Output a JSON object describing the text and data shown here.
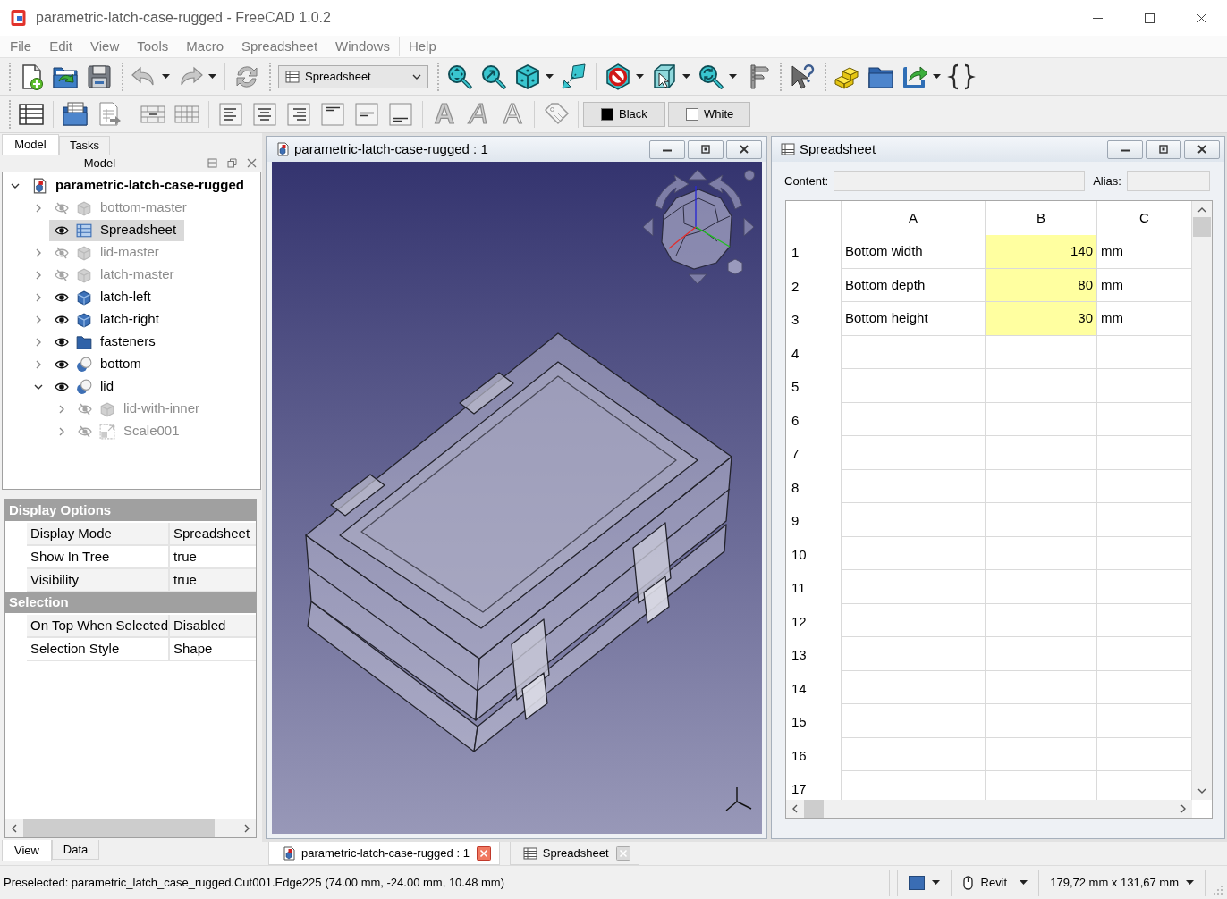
{
  "window": {
    "title": "parametric-latch-case-rugged - FreeCAD 1.0.2"
  },
  "menu_bar": [
    "File",
    "Edit",
    "View",
    "Tools",
    "Macro",
    "Spreadsheet",
    "Windows",
    "Help"
  ],
  "toolbar": {
    "workbench": "Spreadsheet",
    "style_buttons": [
      {
        "glyph": "A",
        "kind": "bold"
      },
      {
        "glyph": "A",
        "kind": "italic"
      },
      {
        "glyph": "A",
        "kind": "outline"
      }
    ],
    "color_buttons": [
      {
        "label": "Black",
        "color": "#000000"
      },
      {
        "label": "White",
        "color": "#ffffff"
      }
    ]
  },
  "combo_view": {
    "tabs": [
      {
        "label": "Model",
        "selected": true
      },
      {
        "label": "Tasks",
        "selected": false
      }
    ],
    "panel_title": "Model",
    "tree": {
      "label": "parametric-latch-case-rugged",
      "selected": false,
      "expanded": true,
      "children": [
        {
          "label": "bottom-master",
          "kind": "part",
          "visible": false,
          "selected": false,
          "expanded": false
        },
        {
          "label": "Spreadsheet",
          "kind": "spreadsheet",
          "visible": true,
          "selected": true
        },
        {
          "label": "lid-master",
          "kind": "part",
          "visible": false,
          "selected": false,
          "expanded": false
        },
        {
          "label": "latch-master",
          "kind": "part",
          "visible": false,
          "selected": false,
          "expanded": false
        },
        {
          "label": "latch-left",
          "kind": "body",
          "visible": true,
          "selected": false,
          "expanded": false
        },
        {
          "label": "latch-right",
          "kind": "body",
          "visible": true,
          "selected": false,
          "expanded": false
        },
        {
          "label": "fasteners",
          "kind": "folder",
          "visible": true,
          "selected": false,
          "expanded": false
        },
        {
          "label": "bottom",
          "kind": "boolean",
          "visible": true,
          "selected": false,
          "expanded": false
        },
        {
          "label": "lid",
          "kind": "boolean",
          "visible": true,
          "selected": false,
          "expanded": true,
          "children": [
            {
              "label": "lid-with-inner",
              "kind": "part",
              "visible": false,
              "selected": false,
              "expanded": false
            },
            {
              "label": "Scale001",
              "kind": "scale",
              "visible": false,
              "selected": false,
              "expanded": false
            }
          ]
        }
      ]
    },
    "property_groups": [
      {
        "name": "Display Options",
        "rows": [
          {
            "name": "Display Mode",
            "value": "Spreadsheet"
          },
          {
            "name": "Show In Tree",
            "value": "true"
          },
          {
            "name": "Visibility",
            "value": "true"
          }
        ]
      },
      {
        "name": "Selection",
        "rows": [
          {
            "name": "On Top When Selected",
            "value": "Disabled"
          },
          {
            "name": "Selection Style",
            "value": "Shape"
          }
        ]
      }
    ],
    "property_tabs": [
      {
        "label": "View",
        "selected": true
      },
      {
        "label": "Data",
        "selected": false
      }
    ]
  },
  "viewer_window": {
    "title": "parametric-latch-case-rugged : 1"
  },
  "spreadsheet_window": {
    "title": "Spreadsheet",
    "content_label": "Content:",
    "alias_label": "Alias:",
    "columns": [
      "A",
      "B",
      "C"
    ],
    "rows": [
      {
        "number": "1",
        "cells": [
          {
            "text": "Bottom width",
            "highlighted": false
          },
          {
            "text": "140",
            "highlighted": true
          },
          {
            "text": "mm",
            "highlighted": false
          }
        ]
      },
      {
        "number": "2",
        "cells": [
          {
            "text": "Bottom depth",
            "highlighted": false
          },
          {
            "text": "80",
            "highlighted": true
          },
          {
            "text": "mm",
            "highlighted": false
          }
        ]
      },
      {
        "number": "3",
        "cells": [
          {
            "text": "Bottom height",
            "highlighted": false
          },
          {
            "text": "30",
            "highlighted": true
          },
          {
            "text": "mm",
            "highlighted": false
          }
        ]
      },
      {
        "number": "4"
      },
      {
        "number": "5"
      },
      {
        "number": "6"
      },
      {
        "number": "7"
      },
      {
        "number": "8"
      },
      {
        "number": "9"
      },
      {
        "number": "10"
      },
      {
        "number": "11"
      },
      {
        "number": "12"
      },
      {
        "number": "13"
      },
      {
        "number": "14"
      },
      {
        "number": "15"
      },
      {
        "number": "16"
      },
      {
        "number": "17"
      }
    ]
  },
  "document_tabs": [
    {
      "label": "parametric-latch-case-rugged : 1",
      "kind": "viewer",
      "selected": true
    },
    {
      "label": "Spreadsheet",
      "kind": "spreadsheet",
      "selected": false
    }
  ],
  "status_bar": {
    "message": "Preselected: parametric_latch_case_rugged.Cut001.Edge225 (74.00 mm, -24.00 mm, 10.48 mm)",
    "navigation_style": "Revit",
    "dimensions": "179,72 mm x 131,67 mm"
  }
}
